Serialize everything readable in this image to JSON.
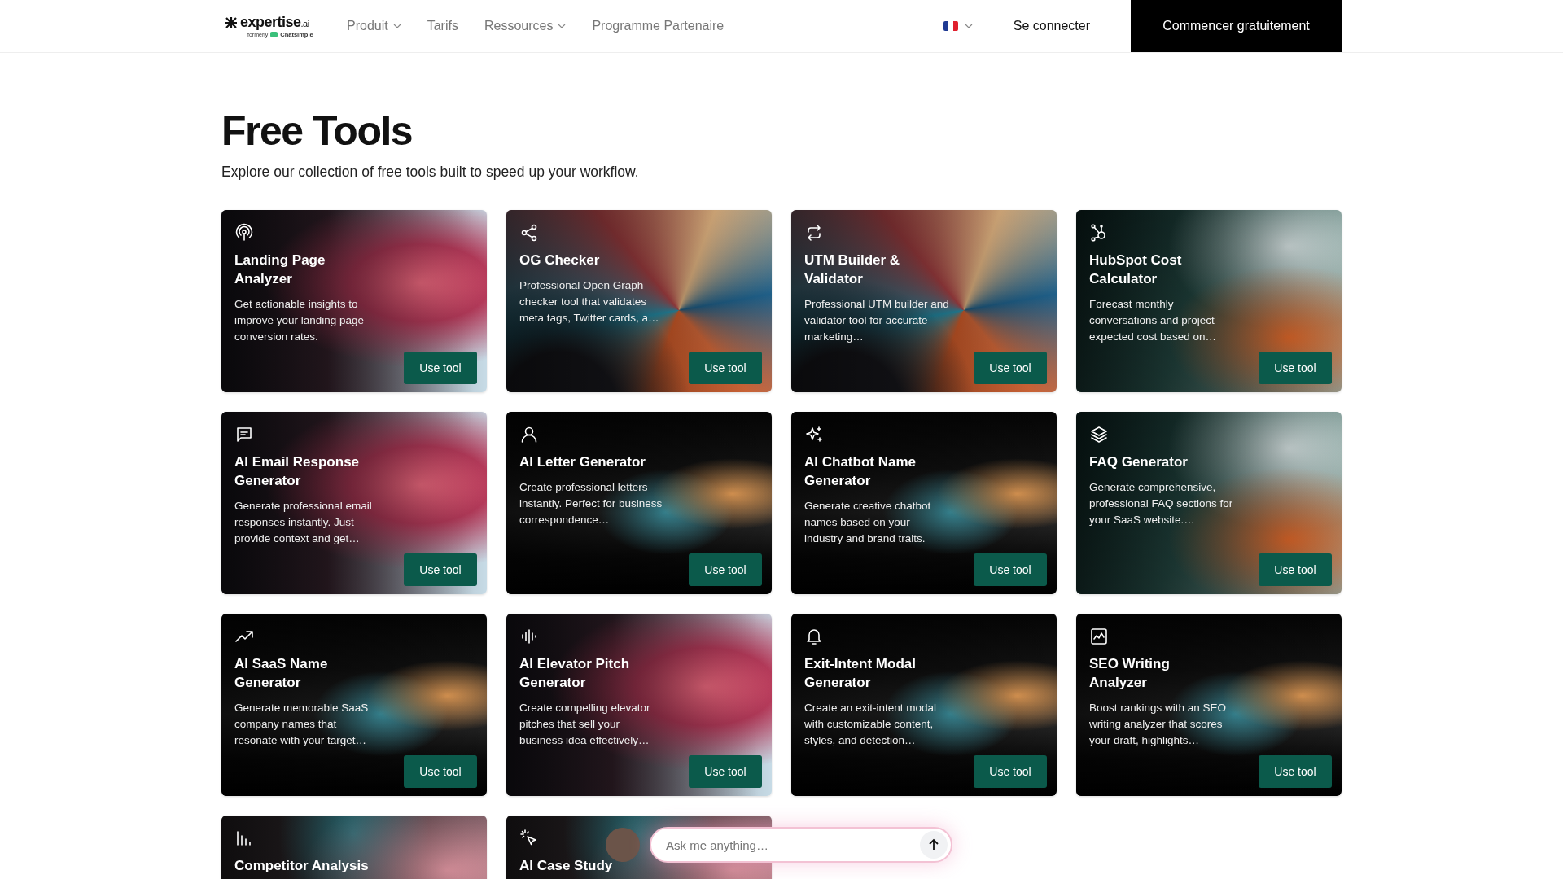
{
  "header": {
    "logo": "expertise",
    "logo_suffix": ".ai",
    "logo_tagline": "formerly",
    "logo_former": "Chatsimple",
    "nav": [
      {
        "label": "Produit",
        "dropdown": true
      },
      {
        "label": "Tarifs",
        "dropdown": false
      },
      {
        "label": "Ressources",
        "dropdown": true
      },
      {
        "label": "Programme Partenaire",
        "dropdown": false
      }
    ],
    "login": "Se connecter",
    "cta": "Commencer gratuitement"
  },
  "title": "Free Tools",
  "subtitle": "Explore our collection of free tools built to speed up your workflow.",
  "tools": [
    {
      "title": "Landing Page Analyzer",
      "description": "Get actionable insights to improve your landing page conversion rates.",
      "button": "Use tool",
      "kind": "pink"
    },
    {
      "title": "OG Checker",
      "description": "Professional Open Graph checker tool that validates meta tags, Twitter cards, a…",
      "button": "Use tool",
      "kind": "swirl"
    },
    {
      "title": "UTM Builder & Validator",
      "description": "Professional UTM builder and validator tool for accurate marketing…",
      "button": "Use tool",
      "kind": "swirl"
    },
    {
      "title": "HubSpot Cost Calculator",
      "description": "Forecast monthly conversations and project expected cost based on…",
      "button": "Use tool",
      "kind": "teal"
    },
    {
      "title": "AI Email Response Generator",
      "description": "Generate professional email responses instantly. Just provide context and get…",
      "button": "Use tool",
      "kind": "pink"
    },
    {
      "title": "AI Letter Generator",
      "description": "Create professional letters instantly. Perfect for business correspondence…",
      "button": "Use tool",
      "kind": "lights"
    },
    {
      "title": "AI Chatbot Name Generator",
      "description": "Generate creative chatbot names based on your industry and brand traits.",
      "button": "Use tool",
      "kind": "lights"
    },
    {
      "title": "FAQ Generator",
      "description": "Generate comprehensive, professional FAQ sections for your SaaS website.…",
      "button": "Use tool",
      "kind": "teal"
    },
    {
      "title": "AI SaaS Name Generator",
      "description": "Generate memorable SaaS company names that resonate with your target…",
      "button": "Use tool",
      "kind": "lights"
    },
    {
      "title": "AI Elevator Pitch Generator",
      "description": "Create compelling elevator pitches that sell your business idea effectively…",
      "button": "Use tool",
      "kind": "pink"
    },
    {
      "title": "Exit-Intent Modal Generator",
      "description": "Create an exit-intent modal with customizable content, styles, and detection…",
      "button": "Use tool",
      "kind": "lights"
    },
    {
      "title": "SEO Writing Analyzer",
      "description": "Boost rankings with an SEO writing analyzer that scores your draft, highlights…",
      "button": "Use tool",
      "kind": "lights"
    },
    {
      "title": "Competitor Analysis",
      "kind": "pastel"
    },
    {
      "title": "AI Case Study",
      "kind": "pastel"
    }
  ],
  "chat": {
    "placeholder": "Ask me anything…"
  }
}
